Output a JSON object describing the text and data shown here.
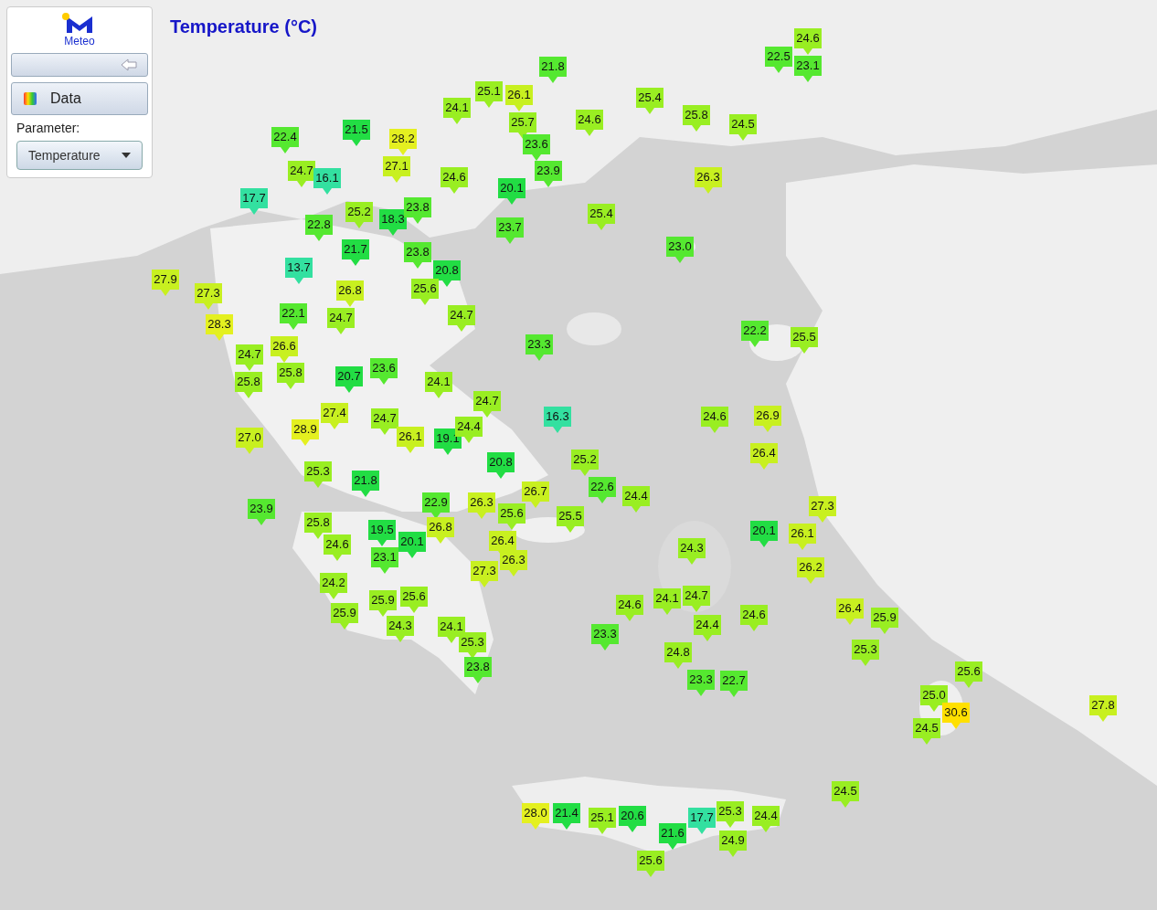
{
  "panel": {
    "logo_text": "Meteo",
    "data_button": "Data",
    "parameter_label": "Parameter:",
    "parameter_select": "Temperature"
  },
  "title": "Temperature (°C)",
  "markers": [
    {
      "value": "21.8",
      "color": "#55e830"
    },
    {
      "value": "25.1",
      "color": "#99ee22"
    },
    {
      "value": "26.1",
      "color": "#c8f020"
    },
    {
      "value": "24.1",
      "color": "#99ee22"
    },
    {
      "value": "25.7",
      "color": "#99ee22"
    },
    {
      "value": "25.4",
      "color": "#99ee22"
    },
    {
      "value": "25.8",
      "color": "#99ee22"
    },
    {
      "value": "24.5",
      "color": "#99ee22"
    },
    {
      "value": "22.5",
      "color": "#55e830"
    },
    {
      "value": "24.6",
      "color": "#99ee22"
    },
    {
      "value": "23.1",
      "color": "#55e830"
    },
    {
      "value": "24.6",
      "color": "#99ee22"
    },
    {
      "value": "23.6",
      "color": "#55e830"
    },
    {
      "value": "23.9",
      "color": "#55e830"
    },
    {
      "value": "26.3",
      "color": "#c8f020"
    },
    {
      "value": "20.1",
      "color": "#22dd44"
    },
    {
      "value": "25.4",
      "color": "#99ee22"
    },
    {
      "value": "23.7",
      "color": "#55e830"
    },
    {
      "value": "23.0",
      "color": "#55e830"
    },
    {
      "value": "22.4",
      "color": "#55e830"
    },
    {
      "value": "21.5",
      "color": "#22dd44"
    },
    {
      "value": "28.2",
      "color": "#e4f020"
    },
    {
      "value": "24.7",
      "color": "#99ee22"
    },
    {
      "value": "16.1",
      "color": "#33e0a0"
    },
    {
      "value": "27.1",
      "color": "#c8f020"
    },
    {
      "value": "24.6",
      "color": "#99ee22"
    },
    {
      "value": "17.7",
      "color": "#33e0a0"
    },
    {
      "value": "25.2",
      "color": "#99ee22"
    },
    {
      "value": "18.3",
      "color": "#22dd44"
    },
    {
      "value": "23.8",
      "color": "#55e830"
    },
    {
      "value": "22.8",
      "color": "#55e830"
    },
    {
      "value": "21.7",
      "color": "#22dd44"
    },
    {
      "value": "23.8",
      "color": "#55e830"
    },
    {
      "value": "20.8",
      "color": "#22dd44"
    },
    {
      "value": "13.7",
      "color": "#33e0a0"
    },
    {
      "value": "27.9",
      "color": "#c8f020"
    },
    {
      "value": "27.3",
      "color": "#c8f020"
    },
    {
      "value": "26.8",
      "color": "#c8f020"
    },
    {
      "value": "25.6",
      "color": "#99ee22"
    },
    {
      "value": "24.7",
      "color": "#99ee22"
    },
    {
      "value": "22.1",
      "color": "#55e830"
    },
    {
      "value": "28.3",
      "color": "#e4f020"
    },
    {
      "value": "24.7",
      "color": "#99ee22"
    },
    {
      "value": "23.3",
      "color": "#55e830"
    },
    {
      "value": "22.2",
      "color": "#55e830"
    },
    {
      "value": "25.5",
      "color": "#99ee22"
    },
    {
      "value": "26.6",
      "color": "#c8f020"
    },
    {
      "value": "24.7",
      "color": "#99ee22"
    },
    {
      "value": "25.8",
      "color": "#99ee22"
    },
    {
      "value": "25.8",
      "color": "#99ee22"
    },
    {
      "value": "20.7",
      "color": "#22dd44"
    },
    {
      "value": "23.6",
      "color": "#55e830"
    },
    {
      "value": "24.1",
      "color": "#99ee22"
    },
    {
      "value": "24.7",
      "color": "#99ee22"
    },
    {
      "value": "16.3",
      "color": "#33e0a0"
    },
    {
      "value": "24.6",
      "color": "#99ee22"
    },
    {
      "value": "26.9",
      "color": "#c8f020"
    },
    {
      "value": "26.4",
      "color": "#c8f020"
    },
    {
      "value": "27.4",
      "color": "#c8f020"
    },
    {
      "value": "28.9",
      "color": "#e4f020"
    },
    {
      "value": "24.7",
      "color": "#99ee22"
    },
    {
      "value": "26.1",
      "color": "#c8f020"
    },
    {
      "value": "19.1",
      "color": "#22dd44"
    },
    {
      "value": "24.4",
      "color": "#99ee22"
    },
    {
      "value": "27.0",
      "color": "#c8f020"
    },
    {
      "value": "25.2",
      "color": "#99ee22"
    },
    {
      "value": "20.8",
      "color": "#22dd44"
    },
    {
      "value": "25.3",
      "color": "#99ee22"
    },
    {
      "value": "21.8",
      "color": "#22dd44"
    },
    {
      "value": "22.6",
      "color": "#55e830"
    },
    {
      "value": "24.4",
      "color": "#99ee22"
    },
    {
      "value": "26.7",
      "color": "#c8f020"
    },
    {
      "value": "22.9",
      "color": "#55e830"
    },
    {
      "value": "26.3",
      "color": "#c8f020"
    },
    {
      "value": "25.6",
      "color": "#99ee22"
    },
    {
      "value": "25.5",
      "color": "#99ee22"
    },
    {
      "value": "23.9",
      "color": "#55e830"
    },
    {
      "value": "25.8",
      "color": "#99ee22"
    },
    {
      "value": "27.3",
      "color": "#c8f020"
    },
    {
      "value": "20.1",
      "color": "#22dd44"
    },
    {
      "value": "26.1",
      "color": "#c8f020"
    },
    {
      "value": "19.5",
      "color": "#22dd44"
    },
    {
      "value": "20.1",
      "color": "#22dd44"
    },
    {
      "value": "26.8",
      "color": "#c8f020"
    },
    {
      "value": "26.4",
      "color": "#c8f020"
    },
    {
      "value": "23.1",
      "color": "#55e830"
    },
    {
      "value": "24.6",
      "color": "#99ee22"
    },
    {
      "value": "24.3",
      "color": "#99ee22"
    },
    {
      "value": "26.3",
      "color": "#c8f020"
    },
    {
      "value": "27.3",
      "color": "#c8f020"
    },
    {
      "value": "26.2",
      "color": "#c8f020"
    },
    {
      "value": "24.2",
      "color": "#99ee22"
    },
    {
      "value": "25.6",
      "color": "#99ee22"
    },
    {
      "value": "25.9",
      "color": "#99ee22"
    },
    {
      "value": "25.9",
      "color": "#99ee22"
    },
    {
      "value": "24.6",
      "color": "#99ee22"
    },
    {
      "value": "24.1",
      "color": "#99ee22"
    },
    {
      "value": "24.7",
      "color": "#99ee22"
    },
    {
      "value": "24.6",
      "color": "#99ee22"
    },
    {
      "value": "26.4",
      "color": "#c8f020"
    },
    {
      "value": "25.9",
      "color": "#99ee22"
    },
    {
      "value": "24.3",
      "color": "#99ee22"
    },
    {
      "value": "24.1",
      "color": "#99ee22"
    },
    {
      "value": "23.3",
      "color": "#55e830"
    },
    {
      "value": "24.4",
      "color": "#99ee22"
    },
    {
      "value": "24.8",
      "color": "#99ee22"
    },
    {
      "value": "25.3",
      "color": "#99ee22"
    },
    {
      "value": "25.3",
      "color": "#99ee22"
    },
    {
      "value": "23.8",
      "color": "#55e830"
    },
    {
      "value": "23.3",
      "color": "#55e830"
    },
    {
      "value": "22.7",
      "color": "#55e830"
    },
    {
      "value": "25.6",
      "color": "#99ee22"
    },
    {
      "value": "25.0",
      "color": "#99ee22"
    },
    {
      "value": "30.6",
      "color": "#ffe000"
    },
    {
      "value": "27.8",
      "color": "#c8f020"
    },
    {
      "value": "24.5",
      "color": "#99ee22"
    },
    {
      "value": "24.5",
      "color": "#99ee22"
    },
    {
      "value": "28.0",
      "color": "#e4f020"
    },
    {
      "value": "21.4",
      "color": "#22dd44"
    },
    {
      "value": "25.1",
      "color": "#99ee22"
    },
    {
      "value": "20.6",
      "color": "#22dd44"
    },
    {
      "value": "17.7",
      "color": "#33e0a0"
    },
    {
      "value": "25.3",
      "color": "#99ee22"
    },
    {
      "value": "24.4",
      "color": "#99ee22"
    },
    {
      "value": "21.6",
      "color": "#22dd44"
    },
    {
      "value": "24.9",
      "color": "#99ee22"
    },
    {
      "value": "25.6",
      "color": "#99ee22"
    }
  ]
}
